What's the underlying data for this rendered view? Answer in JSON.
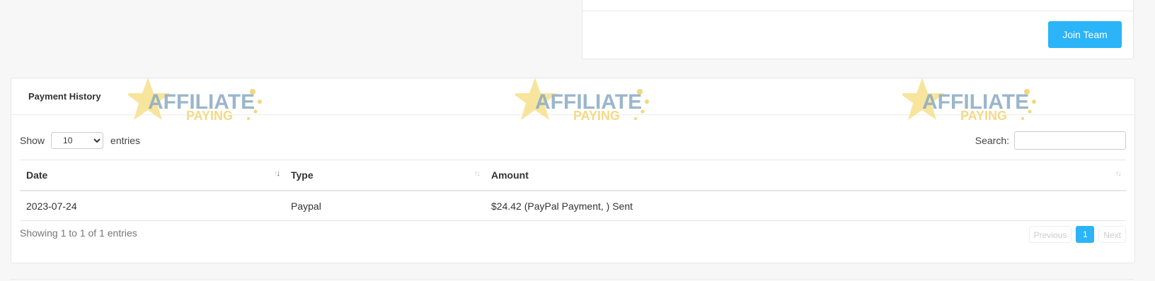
{
  "team": {
    "join_button": "Join Team"
  },
  "payment": {
    "title": "Payment History",
    "watermark_lines": [
      "AFFILIATE",
      "PAYING"
    ],
    "length": {
      "prefix": "Show",
      "selected": "10",
      "suffix": "entries"
    },
    "search": {
      "label": "Search:",
      "value": "",
      "placeholder": ""
    },
    "columns": [
      "Date",
      "Type",
      "Amount"
    ],
    "rows": [
      {
        "date": "2023-07-24",
        "type": "Paypal",
        "amount": "$24.42 (PayPal Payment, ) Sent"
      }
    ],
    "info": "Showing 1 to 1 of 1 entries",
    "pagination": {
      "previous": "Previous",
      "current": "1",
      "next": "Next"
    }
  },
  "colors": {
    "accent": "#2bb4f7",
    "background": "#f7f7f7"
  }
}
